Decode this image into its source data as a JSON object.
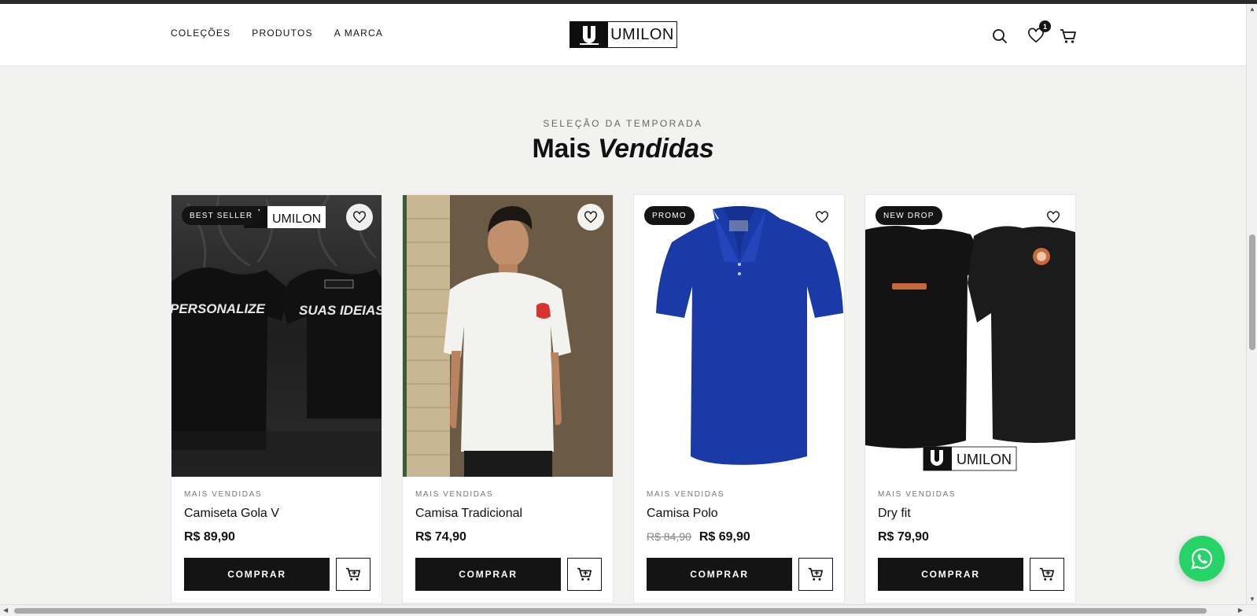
{
  "header": {
    "nav": [
      "COLEÇÕES",
      "PRODUTOS",
      "A MARCA"
    ],
    "logo_text": "UMILON",
    "wishlist_count": "1"
  },
  "section": {
    "kicker": "SELEÇÃO DA TEMPORADA",
    "title_plain": "Mais",
    "title_italic": "Vendidas"
  },
  "products": [
    {
      "tag": "BEST SELLER",
      "category": "MAIS VENDIDAS",
      "name": "Camiseta Gola V",
      "price": "R$ 89,90",
      "old_price": "",
      "buy_label": "COMPRAR",
      "image_text_left": "PERSONALIZE",
      "image_text_right": "SUAS IDEIAS",
      "image_brand": "UMILON"
    },
    {
      "tag": "",
      "category": "MAIS VENDIDAS",
      "name": "Camisa Tradicional",
      "price": "R$ 74,90",
      "old_price": "",
      "buy_label": "COMPRAR"
    },
    {
      "tag": "PROMO",
      "category": "MAIS VENDIDAS",
      "name": "Camisa Polo",
      "price": "R$ 69,90",
      "old_price": "R$ 84,90",
      "buy_label": "COMPRAR"
    },
    {
      "tag": "NEW DROP",
      "category": "MAIS VENDIDAS",
      "name": "Dry fit",
      "price": "R$ 79,90",
      "old_price": "",
      "buy_label": "COMPRAR",
      "image_brand": "UMILON"
    }
  ],
  "colors": {
    "accent": "#141414",
    "background": "#f2f2f0",
    "whatsapp": "#25d366",
    "polo_blue": "#1a3aa8"
  },
  "icons": [
    "search-icon",
    "heart-icon",
    "cart-icon",
    "whatsapp-icon"
  ]
}
